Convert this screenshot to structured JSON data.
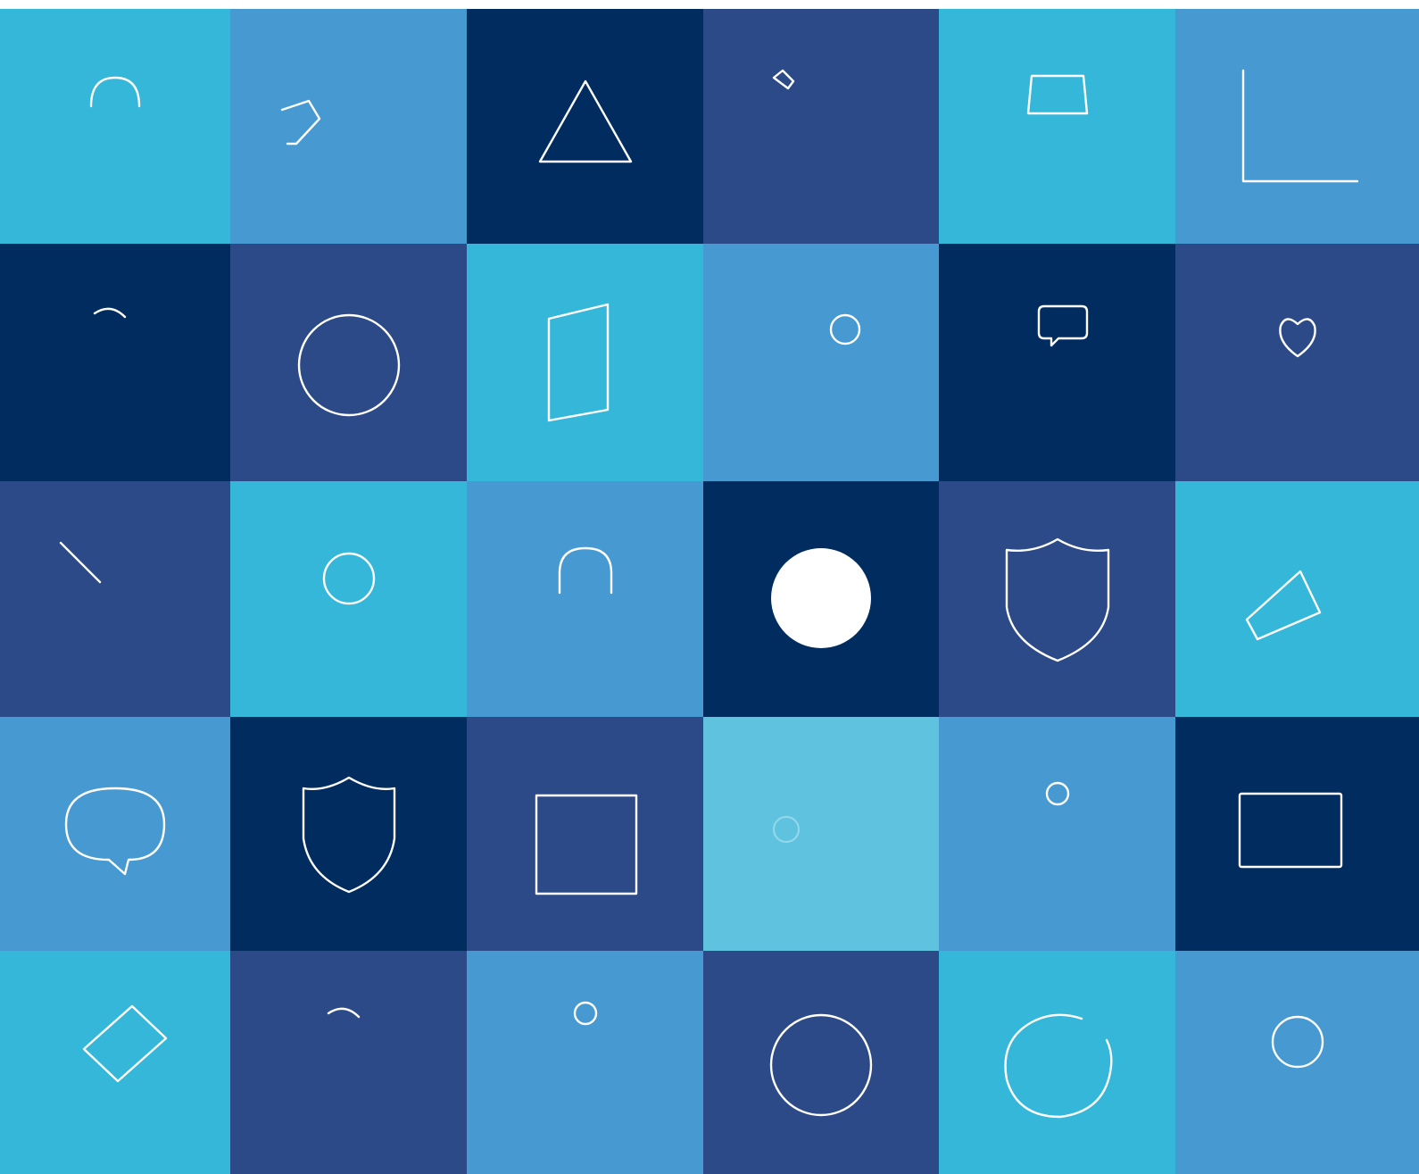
{
  "palette": {
    "light": "#35B7DA",
    "medium": "#4699D1",
    "navy": "#2D4A88",
    "dark": "#002C60",
    "pale": "#5FC3E0",
    "icon_stroke": "#FFFFFF"
  },
  "tiles": [
    {
      "icon": "construction-worker-icon",
      "color": "#35B7DA"
    },
    {
      "icon": "handshake-icon",
      "color": "#4699D1"
    },
    {
      "icon": "warning-icon",
      "color": "#002C60"
    },
    {
      "icon": "tools-icon",
      "color": "#2D4A88"
    },
    {
      "icon": "spy-incognito-icon",
      "color": "#35B7DA"
    },
    {
      "icon": "growth-chart-icon",
      "color": "#4699D1"
    },
    {
      "icon": "people-exchange-icon",
      "color": "#002C60"
    },
    {
      "icon": "justice-network-icon",
      "color": "#2D4A88"
    },
    {
      "icon": "shield-book-icon",
      "color": "#35B7DA"
    },
    {
      "icon": "share-icon",
      "color": "#4699D1"
    },
    {
      "icon": "people-conversation-icon",
      "color": "#002C60"
    },
    {
      "icon": "hands-heart-icon",
      "color": "#2D4A88"
    },
    {
      "icon": "converging-arrows-icon",
      "color": "#2D4A88"
    },
    {
      "icon": "hands-globe-icon",
      "color": "#35B7DA"
    },
    {
      "icon": "padlock-icon",
      "color": "#4699D1"
    },
    {
      "icon": "globe-icon",
      "color": "#002C60"
    },
    {
      "icon": "shield-certificate-icon",
      "color": "#2D4A88"
    },
    {
      "icon": "megaphone-icon",
      "color": "#35B7DA"
    },
    {
      "icon": "chat-bubble-icon",
      "color": "#4699D1"
    },
    {
      "icon": "shield-person-icon",
      "color": "#002C60"
    },
    {
      "icon": "gift-box-icon",
      "color": "#2D4A88"
    },
    {
      "icon": "woman-group-icon",
      "color": "#5FC3E0"
    },
    {
      "icon": "hands-person-icon",
      "color": "#4699D1"
    },
    {
      "icon": "id-badge-shield-icon",
      "color": "#002C60"
    },
    {
      "icon": "hand-money-icon",
      "color": "#35B7DA"
    },
    {
      "icon": "people-exchange-icon",
      "color": "#2D4A88"
    },
    {
      "icon": "org-chart-icon",
      "color": "#4699D1"
    },
    {
      "icon": "justice-network-icon",
      "color": "#2D4A88"
    },
    {
      "icon": "check-circle-icon",
      "color": "#35B7DA"
    },
    {
      "icon": "hands-globe-icon",
      "color": "#4699D1"
    }
  ]
}
